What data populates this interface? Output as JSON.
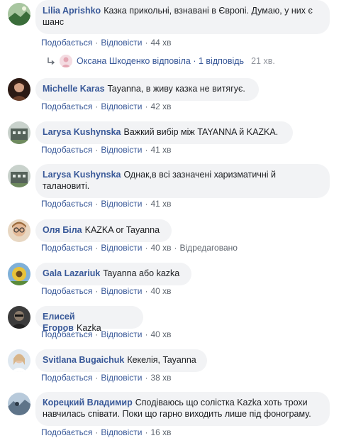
{
  "labels": {
    "like": "Подобається",
    "reply": "Відповісти",
    "sep": "·"
  },
  "comments": [
    {
      "author": "Lilia Aprishko",
      "text": "Казка прикольні, взнавані в Європі. Думаю, у них є шанс",
      "time": "44 хв",
      "avatar_icon": "user-avatar-landscape",
      "avatar_color": "#3a6d3a"
    },
    {
      "author": "Michelle Karas",
      "text": "Tayanna, в живу казка не витягує.",
      "time": "42 хв",
      "avatar_icon": "user-avatar-photo",
      "avatar_color": "#4a2b1e"
    },
    {
      "author": "Larysa Kushynska",
      "text": "Важкий вибір між TAYANNA й KAZKA.",
      "time": "41 хв",
      "avatar_icon": "user-avatar-building",
      "avatar_color": "#55625a"
    },
    {
      "author": "Larysa Kushynska",
      "text": "Однак,в всі зазначені харизматичні й талановиті.",
      "time": "41 хв",
      "avatar_icon": "user-avatar-building",
      "avatar_color": "#55625a"
    },
    {
      "author": "Оля Біла",
      "text": "KAZKA or Tayanna",
      "time": "40 хв",
      "edited": "Відредаговано",
      "avatar_icon": "user-avatar-glasses",
      "avatar_color": "#c9a27a"
    },
    {
      "author": "Gala Lazariuk",
      "text": "Tayanna або kazka",
      "time": "40 хв",
      "avatar_icon": "user-avatar-sunflower",
      "avatar_color": "#d7b13b"
    },
    {
      "author": "Елисей Егоров",
      "text": "Kazka",
      "time": "40 хв",
      "avatar_icon": "user-avatar-photo",
      "avatar_color": "#4b4b4b"
    },
    {
      "author": "Svitlana Bugaichuk",
      "text": "Кекелія, Tayanna",
      "time": "38 хв",
      "avatar_icon": "user-avatar-portrait",
      "avatar_color": "#b7c7d8"
    },
    {
      "author": "Корецкий Владимир",
      "text": "Сподіваюсь що солістка Kazka хоть трохи навчилась співати. Поки що гарно виходить лише під фонограму.",
      "time": "16 хв",
      "avatar_icon": "user-avatar-landscape",
      "avatar_color": "#7f98b0"
    }
  ],
  "reply_summary": {
    "text": "Оксана Шкоденко відповіла · 1 відповідь",
    "time": "21 хв.",
    "icon": "reply-arrow-icon"
  },
  "colors": {
    "author": "#385898",
    "bubble": "#f2f3f5",
    "meta": "#606770"
  }
}
